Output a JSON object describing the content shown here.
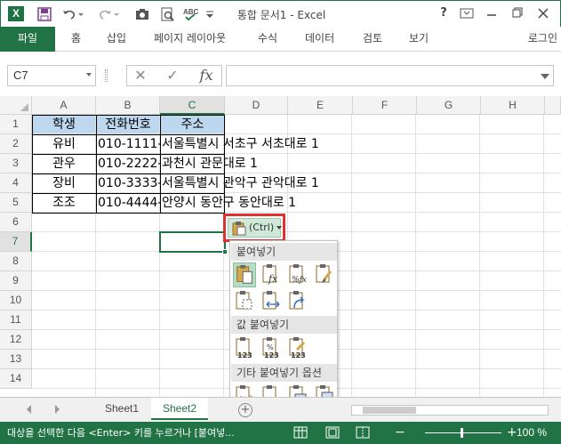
{
  "window": {
    "title": "통합 문서1 - Excel",
    "app_icon_letter": "X",
    "help_label": "?",
    "accent_color": "#217346"
  },
  "ribbon": {
    "file_tab": "파일",
    "tabs": [
      "홈",
      "삽입",
      "페이지 레이아웃",
      "수식",
      "데이터",
      "검토",
      "보기"
    ],
    "login": "로그인"
  },
  "formula_bar": {
    "name_box": "C7",
    "cancel_symbol": "✕",
    "enter_symbol": "✓",
    "fx_label": "fx",
    "value": ""
  },
  "grid": {
    "columns": [
      "A",
      "B",
      "C",
      "D",
      "E",
      "F",
      "G",
      "H"
    ],
    "rows": [
      "1",
      "2",
      "3",
      "4",
      "5",
      "6",
      "7",
      "8",
      "9",
      "10",
      "11",
      "12",
      "13",
      "14"
    ],
    "selected_column": "C",
    "selected_row": "7",
    "header_fill": "#bdd7ee",
    "headers": [
      "학생",
      "전화번호",
      "주소"
    ],
    "data": [
      {
        "name": "유비",
        "phone": "010-1111-",
        "address": "서울특별시 서초구 서초대로 1"
      },
      {
        "name": "관우",
        "phone": "010-2222-",
        "address": "과천시 관문대로 1"
      },
      {
        "name": "장비",
        "phone": "010-3333-",
        "address": "서울특별시 관악구 관악대로 1"
      },
      {
        "name": "조조",
        "phone": "010-4444-",
        "address": "안양시 동안구 동안대로 1"
      }
    ]
  },
  "paste_options": {
    "button_label": "(Ctrl)",
    "highlight_color": "#e03030",
    "sections": [
      "붙여넣기",
      "값 붙여넣기",
      "기타 붙여넣기 옵션"
    ],
    "paste_icons": [
      "paste-icon",
      "paste-formulas-icon",
      "paste-formulas-number-format-icon",
      "keep-source-formatting-icon",
      "no-borders-icon",
      "keep-column-widths-icon",
      "transpose-icon"
    ],
    "value_icons": [
      "paste-values-icon",
      "values-number-format-icon",
      "values-source-formatting-icon"
    ],
    "other_icons": [
      "paste-formatting-icon",
      "paste-link-icon",
      "paste-picture-icon",
      "linked-picture-icon"
    ],
    "icon_badges": {
      "fx": "fx",
      "pct_fx": "%fx",
      "num": "123",
      "pct": "%"
    }
  },
  "sheets": {
    "tabs": [
      "Sheet1",
      "Sheet2"
    ],
    "active": "Sheet2",
    "add_symbol": "+"
  },
  "status": {
    "message": "대상을 선택한 다음 <Enter> 키를 누르거나 [붙여넣...",
    "zoom_out": "−",
    "zoom_in": "+",
    "zoom": "100 %"
  }
}
